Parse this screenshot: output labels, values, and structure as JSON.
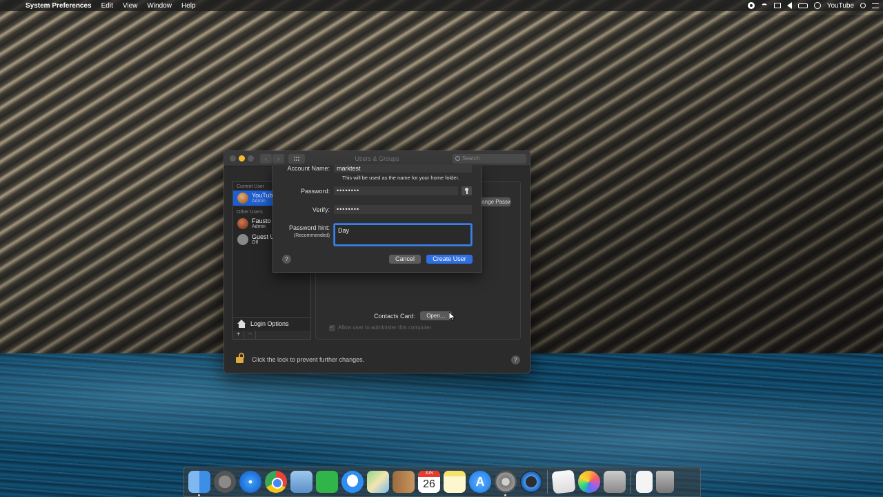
{
  "menubar": {
    "app_name": "System Preferences",
    "menus": [
      "Edit",
      "View",
      "Window",
      "Help"
    ],
    "username": "YouTube",
    "status_icons": [
      "record-icon",
      "wifi-icon",
      "airplay-icon",
      "volume-icon",
      "battery-icon",
      "clock-icon",
      "user-icon",
      "search-icon",
      "list-icon"
    ]
  },
  "window": {
    "title": "Users & Groups",
    "search_placeholder": "Search",
    "sidebar": {
      "current_user_label": "Current User",
      "other_users_label": "Other Users",
      "users": [
        {
          "name": "YouTube",
          "role": "Admin",
          "selected": true
        },
        {
          "name": "Fausto",
          "role": "Admin",
          "selected": false
        },
        {
          "name": "Guest User",
          "role": "Off",
          "selected": false
        }
      ],
      "login_options": "Login Options",
      "add_symbol": "+",
      "remove_symbol": "−"
    },
    "detail": {
      "change_password_button": "Change Password…",
      "contacts_card_label": "Contacts Card:",
      "open_button": "Open…",
      "allow_admin_label": "Allow user to administer this computer",
      "allow_admin_checked": true
    },
    "lock_text": "Click the lock to prevent further changes.",
    "help_symbol": "?"
  },
  "sheet": {
    "account_name_label": "Account Name:",
    "account_name_value": "marktest",
    "account_name_note": "This will be used as the name for your home folder.",
    "password_label": "Password:",
    "password_value": "••••••••",
    "verify_label": "Verify:",
    "verify_value": "••••••••",
    "hint_label": "Password hint:",
    "hint_sublabel": "(Recommended)",
    "hint_value": "Day",
    "help_symbol": "?",
    "cancel_button": "Cancel",
    "create_button": "Create User"
  },
  "dock": {
    "calendar_month": "JUN",
    "calendar_day": "26",
    "apps": [
      "Finder",
      "Launchpad",
      "Safari",
      "Google Chrome",
      "Preview",
      "FaceTime",
      "Messages",
      "Maps",
      "Contacts",
      "Calendar",
      "Notes",
      "App Store",
      "System Preferences",
      "QuickTime Player",
      "TextEdit",
      "Photos",
      "Screenshot",
      "Document",
      "Trash"
    ]
  },
  "colors": {
    "accent": "#2f6fe0",
    "selection": "#1d5fd3",
    "lock": "#e0aa3c"
  }
}
